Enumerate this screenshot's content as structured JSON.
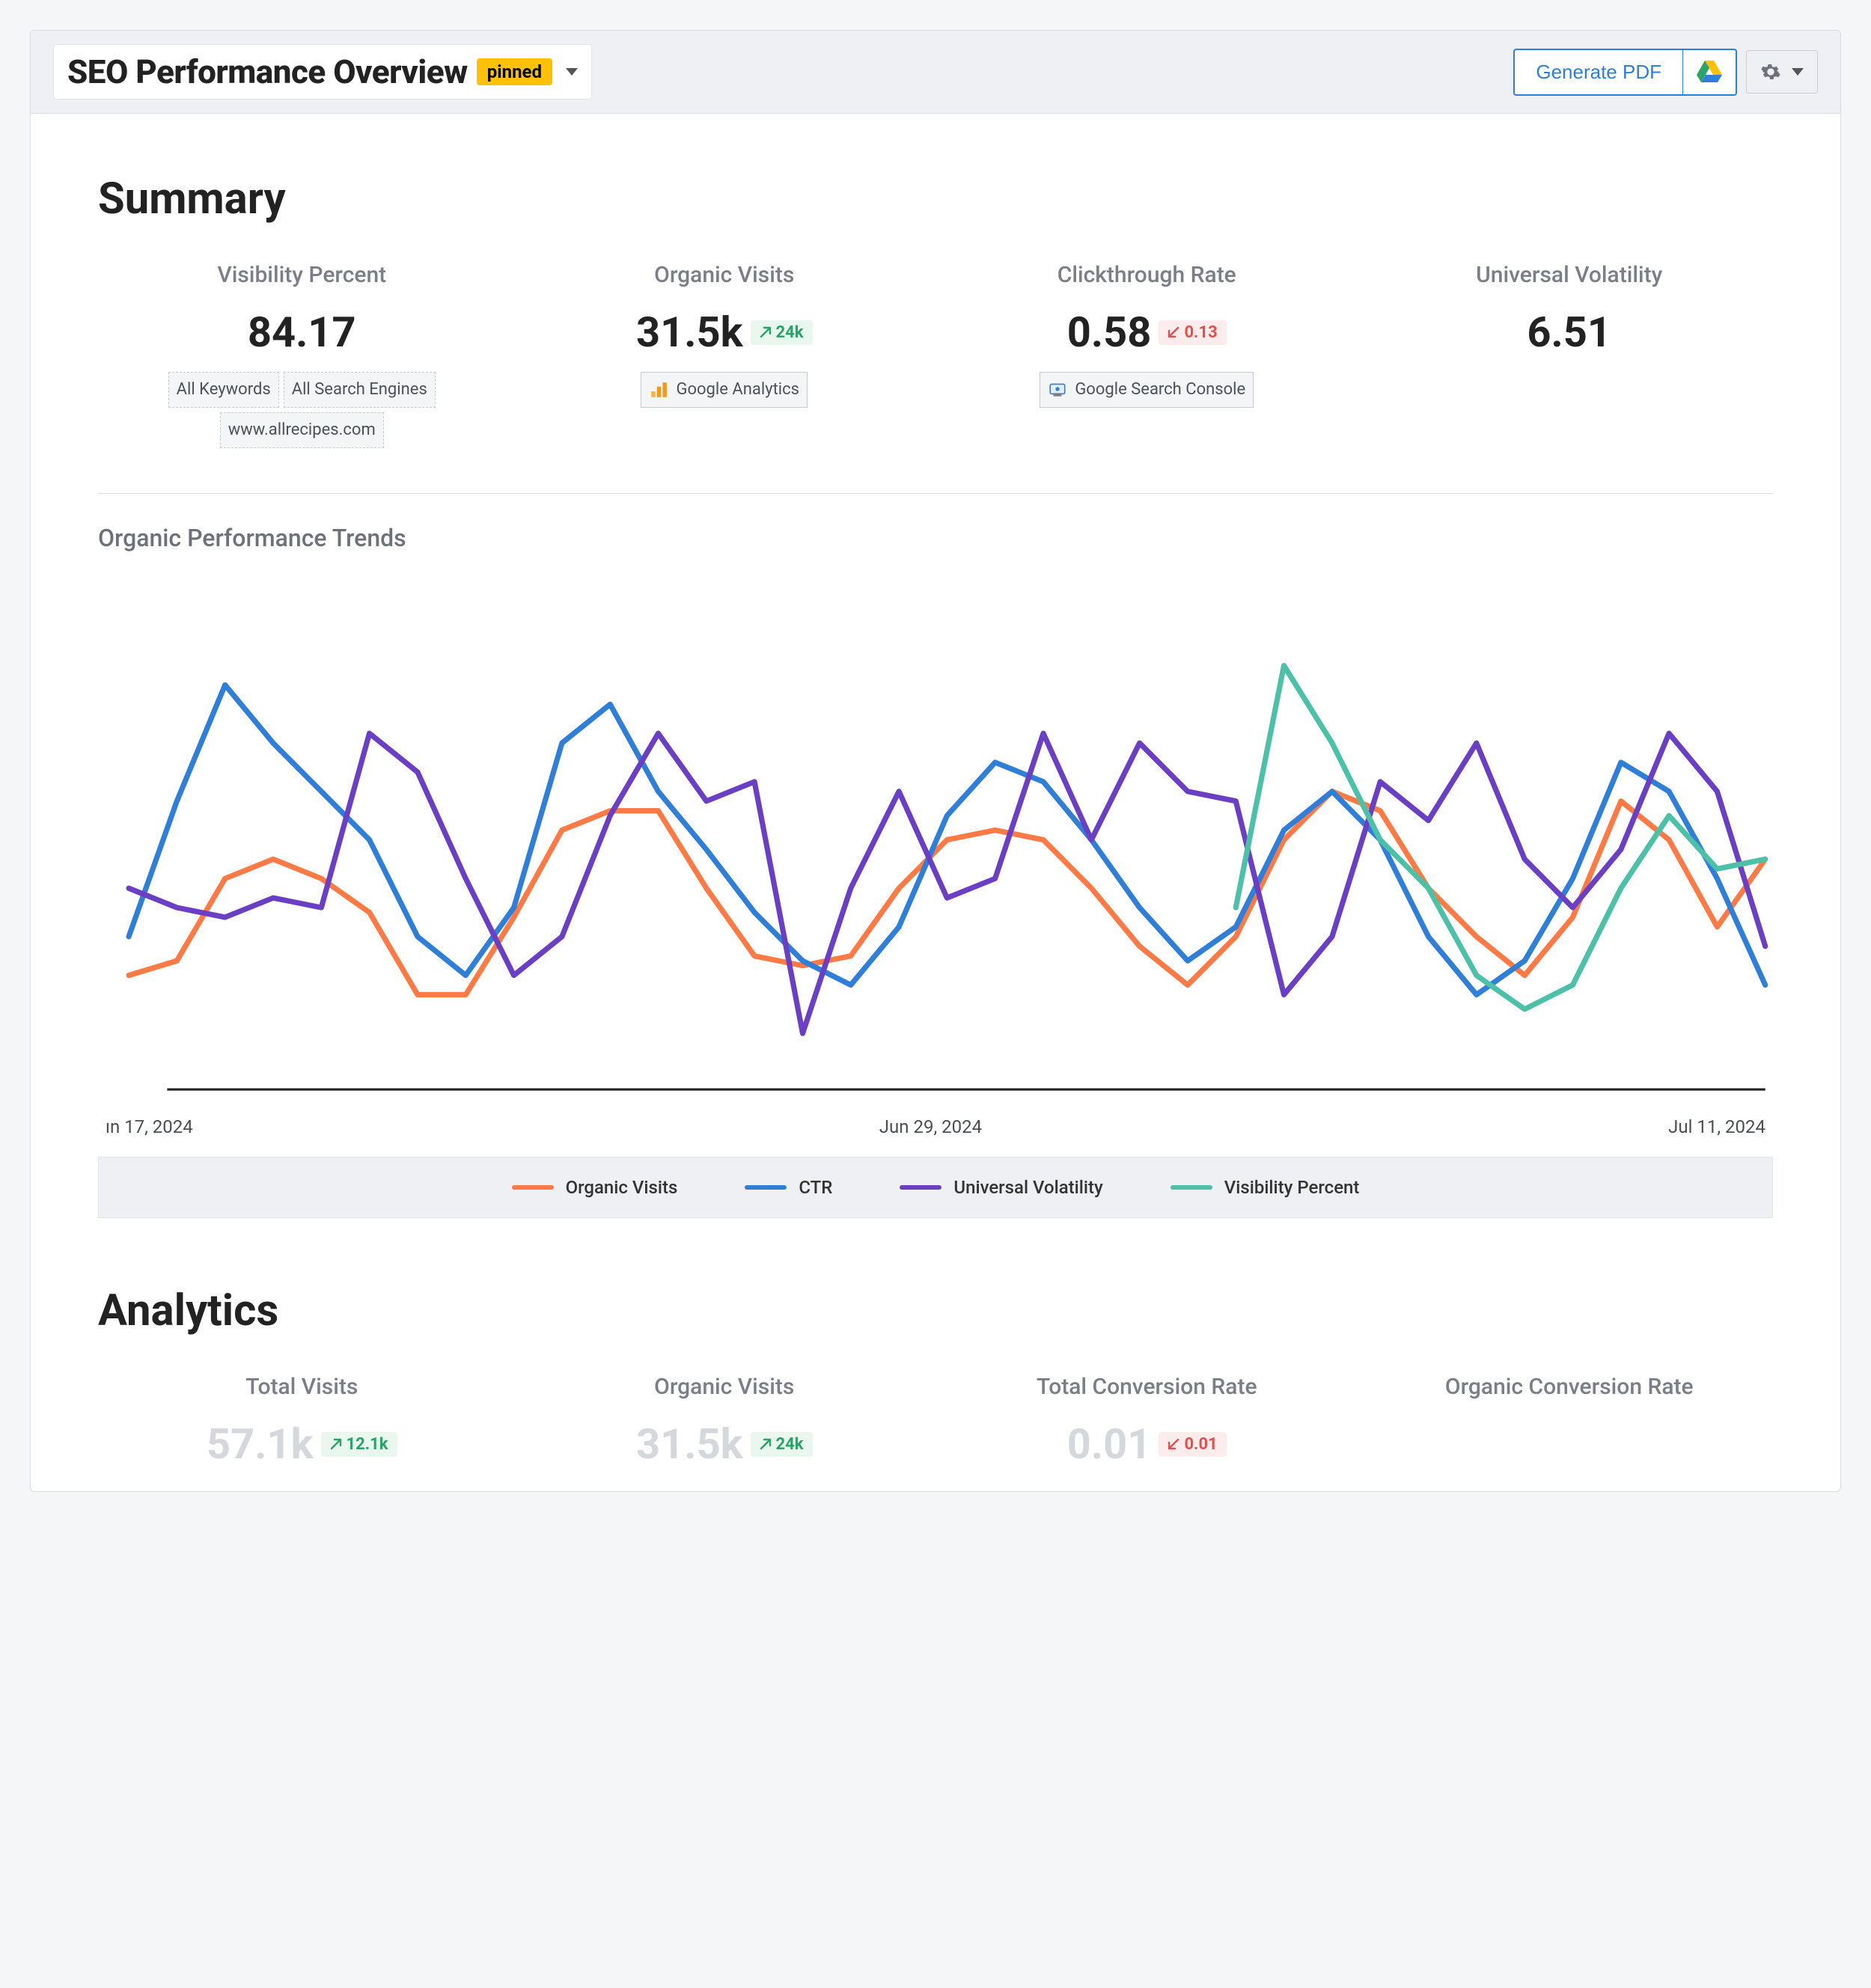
{
  "header": {
    "title": "SEO Performance Overview",
    "pinned_badge": "pinned",
    "generate_pdf": "Generate PDF"
  },
  "colors": {
    "organic_visits": "#ff7a45",
    "ctr": "#2f7fd8",
    "universal_volatility": "#6b3fc4",
    "visibility_percent": "#4dc0a8"
  },
  "sections": {
    "summary_title": "Summary",
    "analytics_title": "Analytics"
  },
  "kpis_summary": [
    {
      "label": "Visibility Percent",
      "value": "84.17",
      "delta": null,
      "tags": [
        "All Keywords",
        "All Search Engines",
        "www.allrecipes.com"
      ],
      "tag_style": "dashed"
    },
    {
      "label": "Organic Visits",
      "value": "31.5k",
      "delta": {
        "dir": "up",
        "text": "24k"
      },
      "tags": [
        "Google Analytics"
      ],
      "tag_icon": "ga",
      "tag_style": "solid"
    },
    {
      "label": "Clickthrough Rate",
      "value": "0.58",
      "delta": {
        "dir": "down",
        "text": "0.13"
      },
      "tags": [
        "Google Search Console"
      ],
      "tag_icon": "gsc",
      "tag_style": "solid"
    },
    {
      "label": "Universal Volatility",
      "value": "6.51",
      "delta": null,
      "tags": []
    }
  ],
  "chart_title": "Organic Performance Trends",
  "chart_data": {
    "type": "line",
    "xlabel": "",
    "ylabel": "",
    "ylim": [
      0,
      100
    ],
    "x_ticks": [
      "ın 17, 2024",
      "Jun 29, 2024",
      "Jul 11, 2024"
    ],
    "legend": [
      "Organic Visits",
      "CTR",
      "Universal Volatility",
      "Visibility Percent"
    ],
    "series": [
      {
        "name": "Organic Visits",
        "color": "#ff7a45",
        "values": [
          22,
          25,
          42,
          46,
          42,
          35,
          18,
          18,
          34,
          52,
          56,
          56,
          40,
          26,
          24,
          26,
          40,
          50,
          52,
          50,
          40,
          28,
          20,
          30,
          50,
          60,
          56,
          40,
          30,
          22,
          34,
          58,
          50,
          32,
          46
        ]
      },
      {
        "name": "CTR",
        "color": "#2f7fd8",
        "values": [
          30,
          58,
          82,
          70,
          60,
          50,
          30,
          22,
          36,
          70,
          78,
          60,
          48,
          35,
          25,
          20,
          32,
          55,
          66,
          62,
          50,
          36,
          25,
          32,
          52,
          60,
          50,
          30,
          18,
          25,
          42,
          66,
          60,
          42,
          20
        ]
      },
      {
        "name": "Universal Volatility",
        "color": "#6b3fc4",
        "values": [
          40,
          36,
          34,
          38,
          36,
          72,
          64,
          42,
          22,
          30,
          55,
          72,
          58,
          62,
          10,
          40,
          60,
          38,
          42,
          72,
          50,
          70,
          60,
          58,
          18,
          30,
          62,
          54,
          70,
          46,
          36,
          48,
          72,
          60,
          28
        ]
      },
      {
        "name": "Visibility Percent",
        "color": "#4dc0a8",
        "values": [
          null,
          null,
          null,
          null,
          null,
          null,
          null,
          null,
          null,
          null,
          null,
          null,
          null,
          null,
          null,
          null,
          null,
          null,
          null,
          null,
          null,
          null,
          null,
          36,
          86,
          70,
          50,
          40,
          22,
          15,
          20,
          40,
          55,
          44,
          46
        ]
      }
    ]
  },
  "kpis_analytics": [
    {
      "label": "Total Visits",
      "value": "57.1k",
      "delta": {
        "dir": "up",
        "text": "12.1k"
      }
    },
    {
      "label": "Organic Visits",
      "value": "31.5k",
      "delta": {
        "dir": "up",
        "text": "24k"
      }
    },
    {
      "label": "Total Conversion Rate",
      "value": "0.01",
      "delta": {
        "dir": "down",
        "text": "0.01"
      }
    },
    {
      "label": "Organic Conversion Rate",
      "value": "",
      "delta": null
    }
  ]
}
